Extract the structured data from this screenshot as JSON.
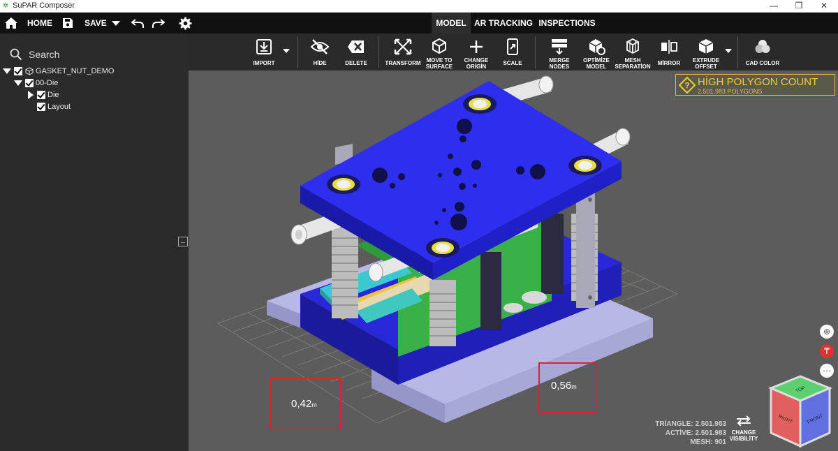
{
  "window": {
    "title": "SuPAR Composer",
    "minimize": "—",
    "restore": "❐",
    "close": "✕"
  },
  "topbar": {
    "home_label": "HOME",
    "save_label": "SAVE",
    "tabs": [
      {
        "label": "MODEL",
        "active": true
      },
      {
        "label": "AR TRACKING",
        "active": false
      },
      {
        "label": "INSPECTIONS",
        "active": false
      }
    ]
  },
  "toolbar": {
    "items": [
      {
        "label": "IMPORT",
        "icon": "import-icon"
      },
      {
        "label": "HİDE",
        "icon": "hide-icon"
      },
      {
        "label": "DELETE",
        "icon": "delete-icon"
      },
      {
        "label": "TRANSFORM",
        "icon": "transform-icon"
      },
      {
        "label1": "MOVE TO",
        "label2": "SURFACE",
        "icon": "move-to-surface-icon"
      },
      {
        "label1": "CHANGE",
        "label2": "ORİGİN",
        "icon": "change-origin-icon"
      },
      {
        "label": "SCALE",
        "icon": "scale-icon"
      },
      {
        "label1": "MERGE",
        "label2": "NODES",
        "icon": "merge-nodes-icon"
      },
      {
        "label1": "OPTİMİZE",
        "label2": "MODEL",
        "icon": "optimize-model-icon"
      },
      {
        "label1": "MESH",
        "label2": "SEPARATİON",
        "icon": "mesh-separation-icon"
      },
      {
        "label": "MİRROR",
        "icon": "mirror-icon"
      },
      {
        "label1": "EXTRUDE",
        "label2": "OFFSET",
        "icon": "extrude-offset-icon"
      },
      {
        "label": "CAD COLOR",
        "icon": "cad-color-icon"
      }
    ]
  },
  "sidebar": {
    "search_label": "Search",
    "tree": [
      {
        "label": "GASKET_NUT_DEMO",
        "checked": true,
        "expanded": true
      },
      {
        "label": "00-Die",
        "checked": true,
        "expanded": true
      },
      {
        "label": "Die",
        "checked": true,
        "expanded": false
      },
      {
        "label": "Layout",
        "checked": true
      }
    ]
  },
  "viewport": {
    "warning": {
      "title": "HİGH POLYGON COUNT",
      "subtitle": "2.501.983 POLYGONS",
      "color": "#f0cd3c"
    },
    "measurements": [
      {
        "value": "0,42",
        "unit": "m"
      },
      {
        "value": "0,56",
        "unit": "m"
      }
    ],
    "stats": {
      "triangle": "TRİANGLE: 2.501.983",
      "active": "ACTİVE: 2.501.983",
      "mesh": "MESH: 901"
    },
    "change_visibility": {
      "line1": "CHANGE",
      "line2": "VİSİBİLİTY"
    },
    "view_cube": {
      "top": "TOP",
      "right": "RIGHT",
      "front": "FRONT"
    }
  },
  "colors": {
    "accent_blue": "#2222cc",
    "warning_yellow": "#f0cd3c",
    "measure_red": "#e0202a"
  }
}
